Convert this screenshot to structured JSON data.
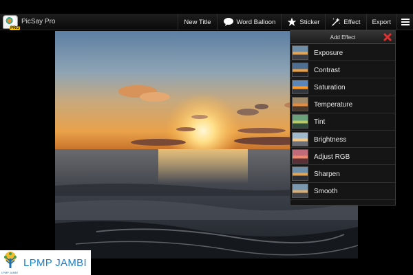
{
  "app": {
    "title": "PicSay Pro",
    "logo_badge": "PRO"
  },
  "toolbar": {
    "new_title": "New Title",
    "word_balloon": "Word Balloon",
    "sticker": "Sticker",
    "effect": "Effect",
    "export": "Export"
  },
  "effect_panel": {
    "title": "Add Effect",
    "items": [
      {
        "label": "Exposure"
      },
      {
        "label": "Contrast"
      },
      {
        "label": "Saturation"
      },
      {
        "label": "Temperature"
      },
      {
        "label": "Tint"
      },
      {
        "label": "Brightness"
      },
      {
        "label": "Adjust RGB"
      },
      {
        "label": "Sharpen"
      },
      {
        "label": "Smooth"
      }
    ]
  },
  "watermark": {
    "text": "LPMP JAMBI",
    "caption": "LPMP JAMBI"
  },
  "colors": {
    "close_red": "#e03030",
    "accent_blue": "#1b82c9"
  },
  "icons": {
    "word_balloon": "speech-bubble-icon",
    "sticker": "star-icon",
    "effect": "magic-wand-icon",
    "menu": "hamburger-menu-icon",
    "close": "close-x-icon"
  }
}
